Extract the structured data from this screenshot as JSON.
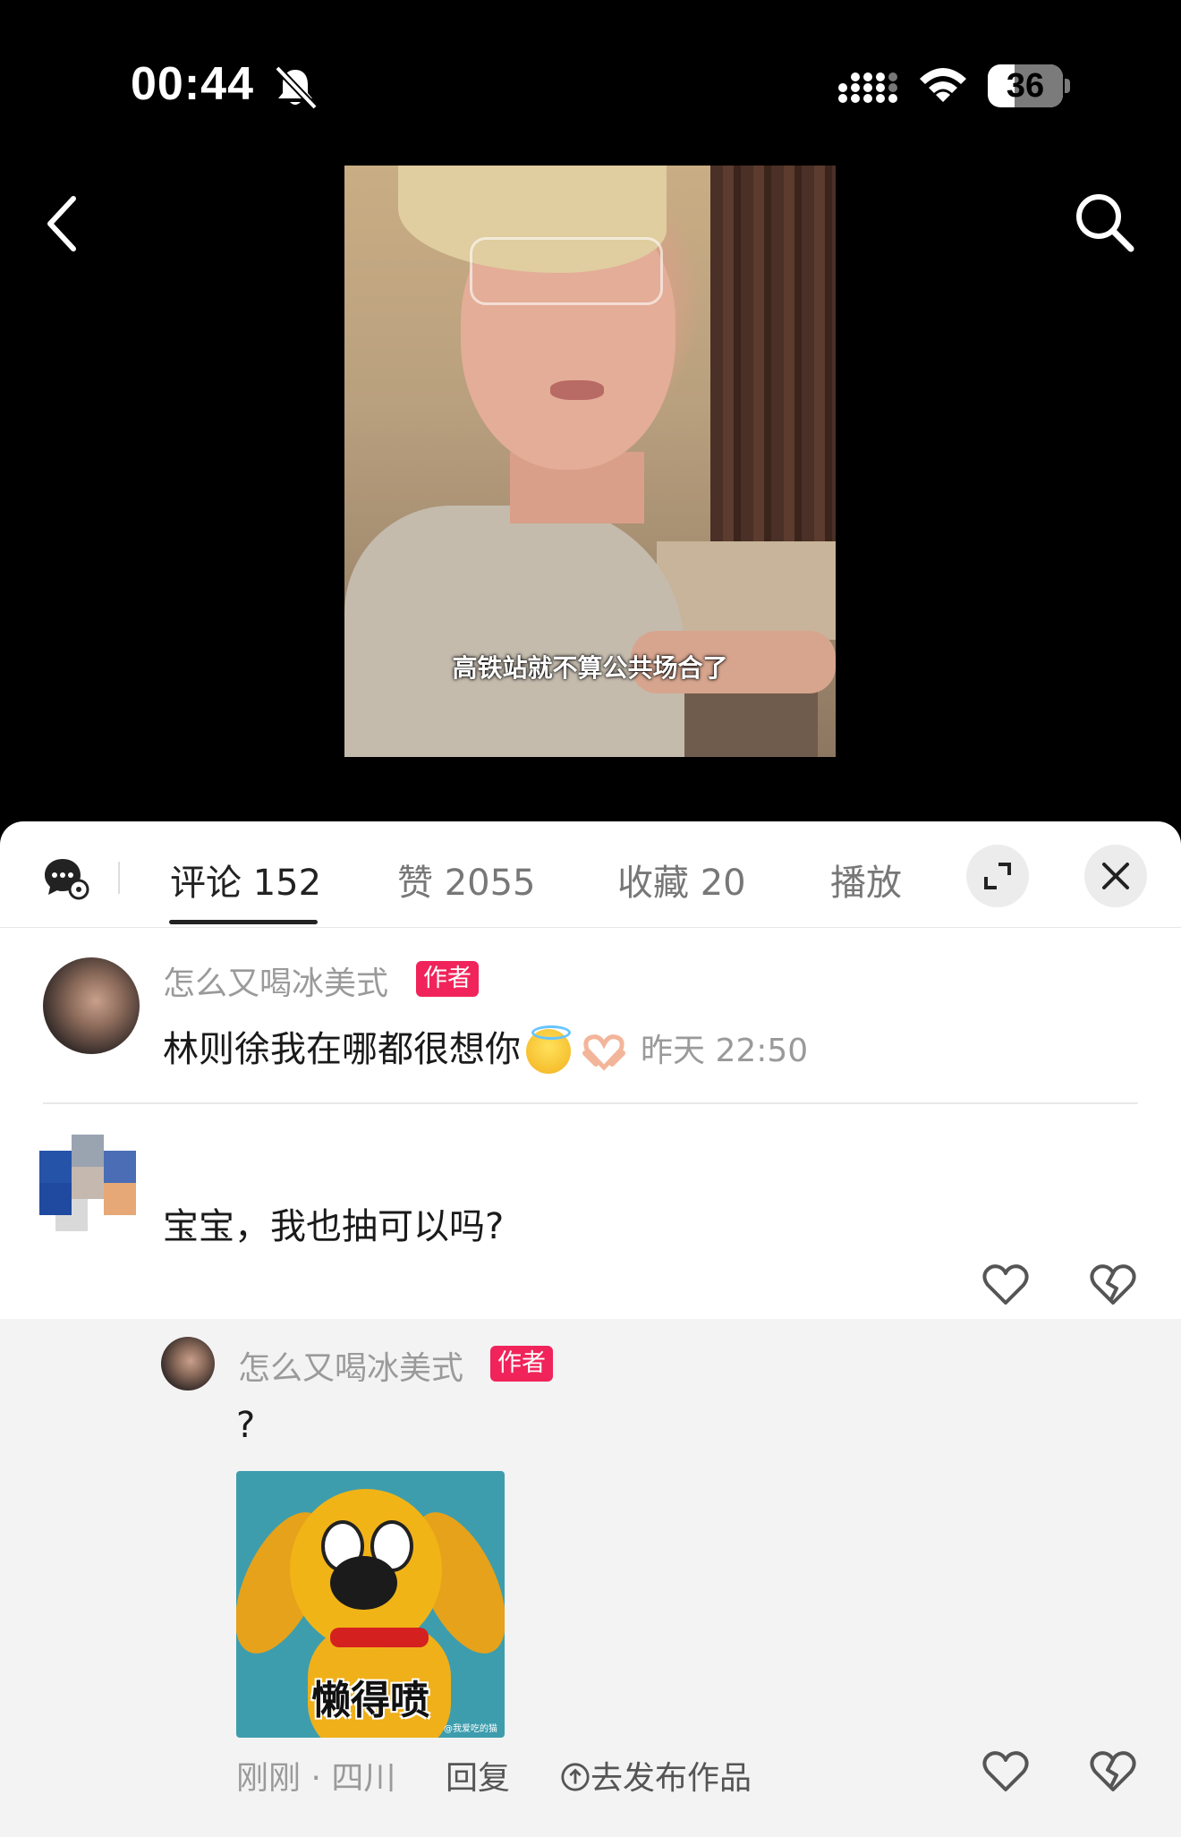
{
  "status_bar": {
    "time": "00:44",
    "battery": "36"
  },
  "video": {
    "caption": "高铁站就不算公共场合了"
  },
  "tabs": {
    "comments": "评论 152",
    "likes": "赞 2055",
    "favorites": "收藏 20",
    "plays": "播放"
  },
  "comments": [
    {
      "username": "怎么又喝冰美式",
      "badge": "作者",
      "text": "林则徐我在哪都很想你",
      "time": "昨天 22:50"
    },
    {
      "username": "",
      "text": "宝宝，我也抽可以吗?",
      "meta": ""
    }
  ],
  "reply": {
    "username": "怎么又喝冰美式",
    "badge": "作者",
    "text": "?",
    "sticker_text": "懒得喷",
    "sticker_watermark": "@我爱吃的猫",
    "time_location": "刚刚 · 四川",
    "reply_label": "回复",
    "publish_label": "去发布作品"
  },
  "colors": {
    "author_badge": "#f0245a",
    "panel_bg": "#ffffff",
    "reply_bg": "#f3f3f3"
  }
}
